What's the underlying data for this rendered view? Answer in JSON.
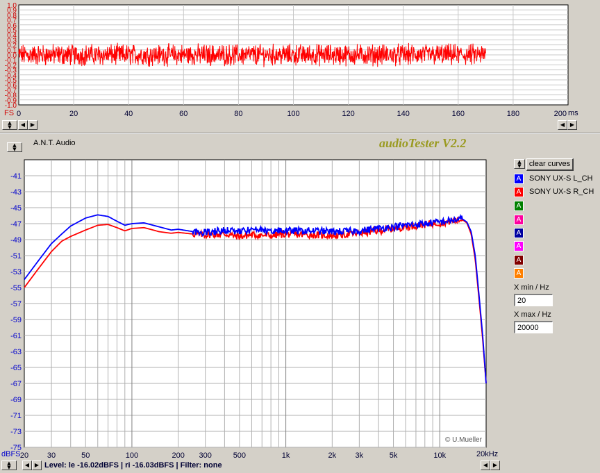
{
  "time_plot": {
    "y_ticks": [
      "1.0",
      "0.9",
      "0.8",
      "0.7",
      "0.6",
      "0.5",
      "0.4",
      "0.3",
      "0.2",
      "0.1",
      "0.0",
      "-0.1",
      "-0.2",
      "-0.3",
      "-0.4",
      "-0.5",
      "-0.6",
      "-0.7",
      "-0.8",
      "-0.9",
      "-1.0"
    ],
    "y_values": [
      1.0,
      0.9,
      0.8,
      0.7,
      0.6,
      0.5,
      0.4,
      0.3,
      0.2,
      0.1,
      0.0,
      -0.1,
      -0.2,
      -0.3,
      -0.4,
      -0.5,
      -0.6,
      -0.7,
      -0.8,
      -0.9,
      -1.0
    ],
    "x_ticks": [
      "0",
      "20",
      "40",
      "60",
      "80",
      "100",
      "120",
      "140",
      "160",
      "180",
      "200"
    ],
    "x_values": [
      0,
      20,
      40,
      60,
      80,
      100,
      120,
      140,
      160,
      180,
      200
    ],
    "y_unit": "FS",
    "x_unit": "ms",
    "color": "#ff0000"
  },
  "header": {
    "company": "A.N.T. Audio",
    "app_title": "audioTester V2.2",
    "copyright": "© U.Mueller"
  },
  "legend": {
    "clear_label": "clear curves",
    "items": [
      {
        "label": "SONY UX-S L_CH",
        "color": "#0000ff",
        "swatch": "A"
      },
      {
        "label": "SONY UX-S R_CH",
        "color": "#ff0000",
        "swatch": "A"
      },
      {
        "label": "",
        "color": "#008000",
        "swatch": "A"
      },
      {
        "label": "",
        "color": "#ff00a0",
        "swatch": "A"
      },
      {
        "label": "",
        "color": "#0000a0",
        "swatch": "A"
      },
      {
        "label": "",
        "color": "#ff00ff",
        "swatch": "A"
      },
      {
        "label": "",
        "color": "#800000",
        "swatch": "A"
      },
      {
        "label": "",
        "color": "#ff8000",
        "swatch": "A"
      }
    ]
  },
  "controls": {
    "xmin_label": "X min / Hz",
    "xmin_value": "20",
    "xmax_label": "X max / Hz",
    "xmax_value": "20000"
  },
  "status": {
    "text": "Level: le -16.02dBFS | ri -16.03dBFS | Filter: none"
  },
  "chart_data": {
    "type": "line",
    "xscale": "log",
    "xlim": [
      20,
      20000
    ],
    "ylim": [
      -75,
      -39
    ],
    "y_unit": "dBFS",
    "x_unit": "Hz",
    "y_ticks": [
      -41,
      -43,
      -45,
      -47,
      -49,
      -51,
      -53,
      -55,
      -57,
      -59,
      -61,
      -63,
      -65,
      -67,
      -69,
      -71,
      -73,
      -75
    ],
    "x_ticks": [
      {
        "v": 20,
        "label": "20"
      },
      {
        "v": 30,
        "label": "30"
      },
      {
        "v": 50,
        "label": "50"
      },
      {
        "v": 100,
        "label": "100"
      },
      {
        "v": 200,
        "label": "200"
      },
      {
        "v": 300,
        "label": "300"
      },
      {
        "v": 500,
        "label": "500"
      },
      {
        "v": 1000,
        "label": "1k"
      },
      {
        "v": 2000,
        "label": "2k"
      },
      {
        "v": 3000,
        "label": "3k"
      },
      {
        "v": 5000,
        "label": "5k"
      },
      {
        "v": 10000,
        "label": "10k"
      }
    ],
    "x_end_label": "20kHz",
    "series": [
      {
        "name": "SONY UX-S L_CH",
        "color": "#0000ff",
        "x": [
          20,
          25,
          30,
          35,
          40,
          50,
          60,
          70,
          80,
          90,
          100,
          120,
          150,
          180,
          200,
          250,
          300,
          400,
          500,
          600,
          800,
          1000,
          1500,
          2000,
          3000,
          4000,
          5000,
          6000,
          8000,
          10000,
          12000,
          14000,
          15000,
          16000,
          17000,
          18000,
          19000,
          20000
        ],
        "y": [
          -54,
          -51.5,
          -49.5,
          -48.3,
          -47.3,
          -46.3,
          -45.9,
          -46.1,
          -46.7,
          -47.2,
          -47.0,
          -46.9,
          -47.4,
          -47.8,
          -47.7,
          -48.0,
          -48.1,
          -47.8,
          -48.0,
          -47.8,
          -47.9,
          -47.9,
          -47.9,
          -48.0,
          -47.9,
          -47.6,
          -47.4,
          -47.2,
          -47.0,
          -46.8,
          -46.6,
          -46.4,
          -46.8,
          -48.0,
          -51.0,
          -56.0,
          -61.0,
          -67.0
        ]
      },
      {
        "name": "SONY UX-S R_CH",
        "color": "#ff0000",
        "x": [
          20,
          25,
          30,
          35,
          40,
          50,
          60,
          70,
          80,
          90,
          100,
          120,
          150,
          180,
          200,
          250,
          300,
          400,
          500,
          600,
          800,
          1000,
          1500,
          2000,
          3000,
          4000,
          5000,
          6000,
          8000,
          10000,
          12000,
          14000,
          15000,
          16000,
          17000,
          18000,
          19000,
          20000
        ],
        "y": [
          -55,
          -52.5,
          -50.5,
          -49.2,
          -48.6,
          -47.8,
          -47.2,
          -47.1,
          -47.5,
          -47.9,
          -47.6,
          -47.5,
          -48.0,
          -48.2,
          -48.1,
          -48.3,
          -48.4,
          -48.3,
          -48.6,
          -48.4,
          -48.5,
          -48.3,
          -48.4,
          -48.5,
          -48.2,
          -47.9,
          -47.6,
          -47.4,
          -47.1,
          -46.9,
          -46.7,
          -46.5,
          -46.9,
          -48.3,
          -51.5,
          -56.5,
          -61.5,
          -67.0
        ]
      }
    ]
  }
}
